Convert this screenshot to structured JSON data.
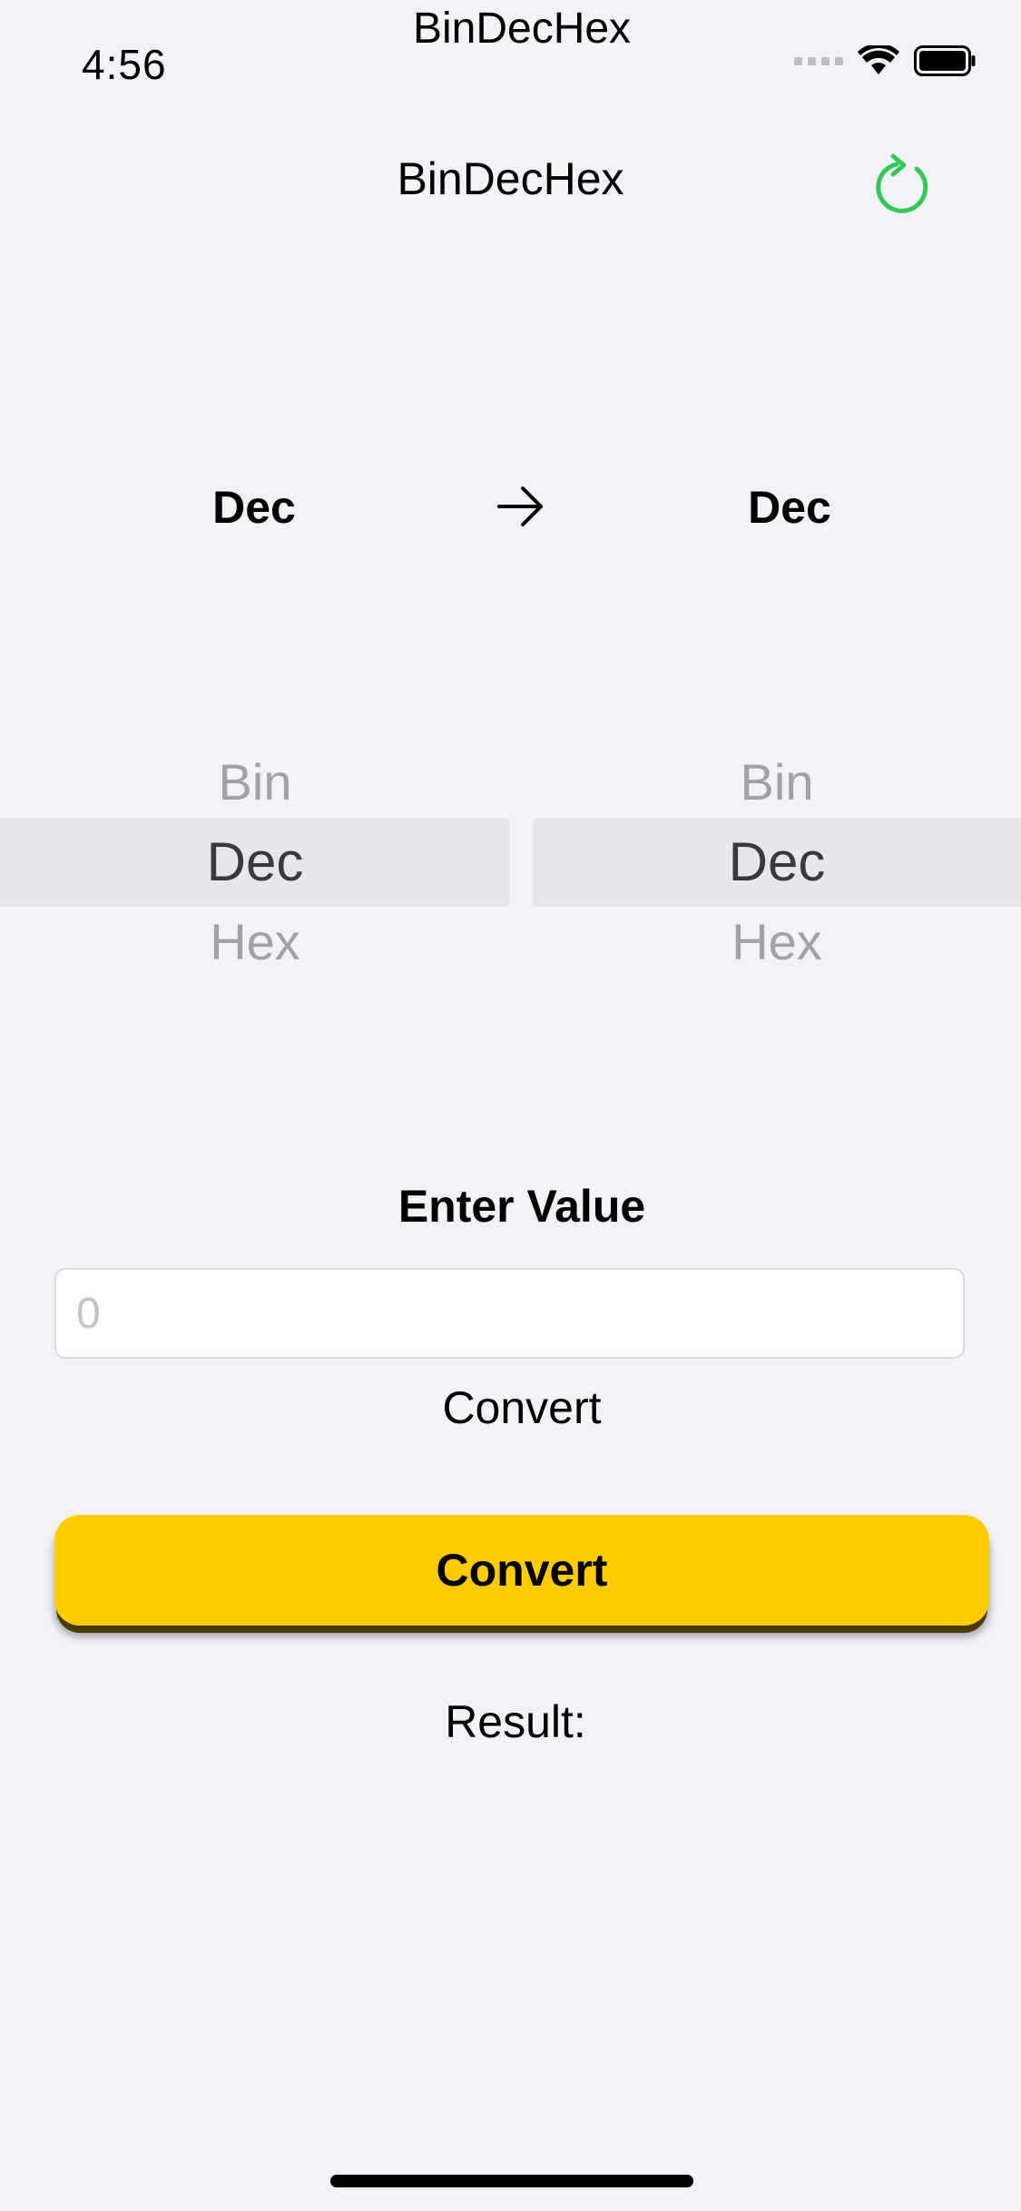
{
  "status_bar": {
    "time": "4:56",
    "app_title": "BinDecHex"
  },
  "nav": {
    "title": "BinDecHex",
    "refresh_icon": "refresh-icon",
    "accent_color": "#34c759"
  },
  "conversion": {
    "from": "Dec",
    "to": "Dec",
    "arrow_icon": "arrow-right-icon"
  },
  "pickers": {
    "from": {
      "options": [
        "Bin",
        "Dec",
        "Hex"
      ],
      "selected": "Dec"
    },
    "to": {
      "options": [
        "Bin",
        "Dec",
        "Hex"
      ],
      "selected": "Dec"
    }
  },
  "input": {
    "label": "Enter Value",
    "placeholder": "0",
    "value": ""
  },
  "convert_caption": "Convert",
  "convert_button": {
    "label": "Convert",
    "color": "#ffcc00"
  },
  "result": {
    "label": "Result:"
  }
}
